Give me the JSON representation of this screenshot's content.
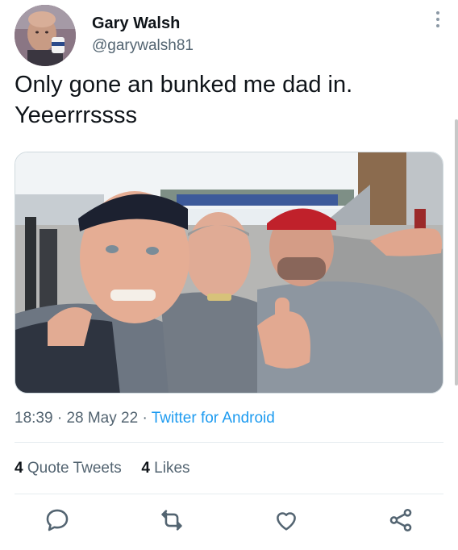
{
  "user": {
    "name": "Gary Walsh",
    "handle": "@garywalsh81"
  },
  "tweet": {
    "text": "Only gone an bunked me dad in.\nYeeerrrssss",
    "time": "18:39",
    "date": "28 May 22",
    "source": "Twitter for Android",
    "separator": "·"
  },
  "stats": {
    "quote_tweets_count": "4",
    "quote_tweets_label": "Quote Tweets",
    "likes_count": "4",
    "likes_label": "Likes"
  },
  "icons": {
    "reply": "reply-icon",
    "retweet": "retweet-icon",
    "like": "like-icon",
    "share": "share-icon",
    "more": "more-icon"
  },
  "colors": {
    "text": "#0f1419",
    "secondary": "#536471",
    "link": "#1d9bf0",
    "divider": "#e6ecf0"
  }
}
